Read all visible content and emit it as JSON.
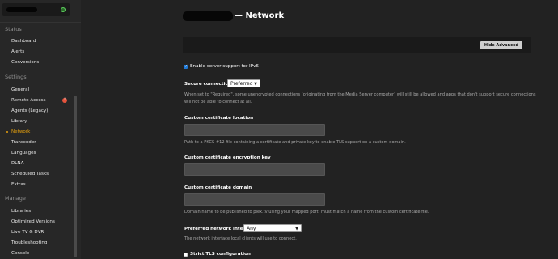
{
  "sidebar": {
    "sections": {
      "status": "Status",
      "settings": "Settings",
      "manage": "Manage"
    },
    "status_items": [
      "Dashboard",
      "Alerts",
      "Conversions"
    ],
    "settings_items": [
      "General",
      "Remote Access",
      "Agents (Legacy)",
      "Library",
      "Network",
      "Transcoder",
      "Languages",
      "DLNA",
      "Scheduled Tasks",
      "Extras"
    ],
    "manage_items": [
      "Libraries",
      "Optimized Versions",
      "Live TV & DVR",
      "Troubleshooting",
      "Console"
    ],
    "active_item": "Network",
    "warning_badge": "!",
    "accent_color": "#e5a00d"
  },
  "header": {
    "title": "— Network"
  },
  "toolbar": {
    "hide_advanced_label": "Hide Advanced"
  },
  "settings": {
    "ipv6": {
      "label": "Enable server support for IPv6",
      "checked": true
    },
    "secure_connections": {
      "label": "Secure connections",
      "value": "Preferred",
      "help": "When set to \"Required\", some unencrypted connections (originating from the Media Server computer) will still be allowed and apps that don't support secure connections will not be able to connect at all."
    },
    "cert_location": {
      "label": "Custom certificate location",
      "value": "",
      "help": "Path to a PKCS #12 file containing a certificate and private key to enable TLS support on a custom domain."
    },
    "cert_key": {
      "label": "Custom certificate encryption key",
      "value": ""
    },
    "cert_domain": {
      "label": "Custom certificate domain",
      "value": "",
      "help": "Domain name to be published to plex.tv using your mapped port; must match a name from the custom certificate file."
    },
    "network_interface": {
      "label": "Preferred network interface",
      "value": "Any",
      "help": "The network interface local clients will use to connect."
    },
    "strict_tls": {
      "label": "Strict TLS configuration",
      "checked": false
    }
  }
}
